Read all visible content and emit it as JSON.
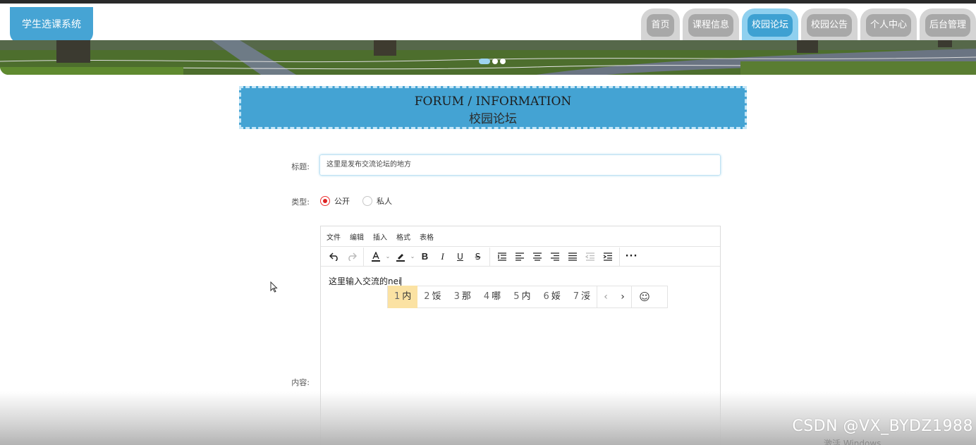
{
  "app": {
    "logo": "学生选课系统"
  },
  "nav": [
    {
      "label": "首页",
      "active": false
    },
    {
      "label": "课程信息",
      "active": false
    },
    {
      "label": "校园论坛",
      "active": true
    },
    {
      "label": "校园公告",
      "active": false
    },
    {
      "label": "个人中心",
      "active": false
    },
    {
      "label": "后台管理",
      "active": false
    }
  ],
  "banner": {
    "dots": 3,
    "active_dot": 1
  },
  "section": {
    "title_en": "FORUM / INFORMATION",
    "title_cn": "校园论坛"
  },
  "form": {
    "title_label": "标题:",
    "title_value": "这里是发布交流论坛的地方",
    "type_label": "类型:",
    "type_options": [
      {
        "label": "公开",
        "checked": true
      },
      {
        "label": "私人",
        "checked": false
      }
    ],
    "content_label": "内容:"
  },
  "editor": {
    "menus": [
      "文件",
      "编辑",
      "插入",
      "格式",
      "表格"
    ],
    "toolbar_icons": [
      "undo-icon",
      "redo-icon",
      "font-color-icon",
      "highlight-icon",
      "bold-icon",
      "italic-icon",
      "underline-icon",
      "strikethrough-icon",
      "line-height-icon",
      "align-left-icon",
      "align-center-icon",
      "align-right-icon",
      "justify-icon",
      "outdent-icon",
      "indent-icon",
      "more-icon"
    ],
    "content_text": "这里输入交流的nei"
  },
  "ime": {
    "candidates": [
      {
        "n": "1",
        "text": "内"
      },
      {
        "n": "2",
        "text": "馁"
      },
      {
        "n": "3",
        "text": "那"
      },
      {
        "n": "4",
        "text": "哪"
      },
      {
        "n": "5",
        "text": "内"
      },
      {
        "n": "6",
        "text": "娞"
      },
      {
        "n": "7",
        "text": "浽"
      }
    ],
    "selected_index": 0
  },
  "watermark": "CSDN @VX_BYDZ1988",
  "activate_text": "激活 Windows",
  "colors": {
    "accent": "#44a3d3",
    "nav_inactive": "#a8a8a8",
    "radio_checked": "#dd2222"
  }
}
